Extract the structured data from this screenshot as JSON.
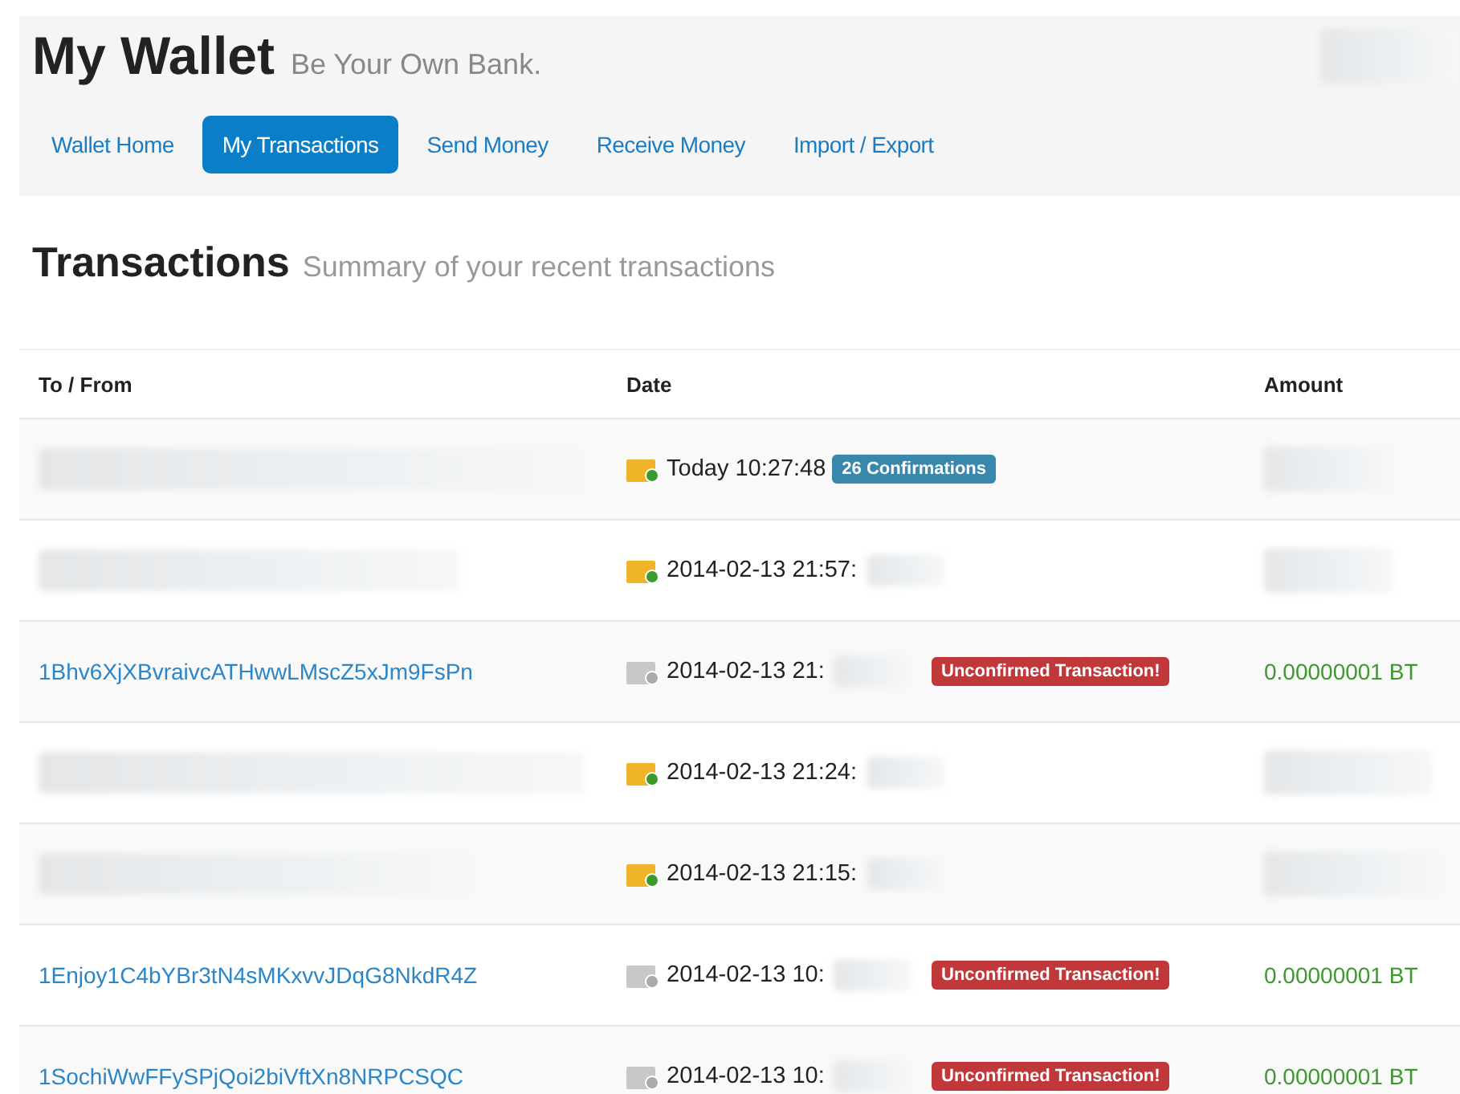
{
  "header": {
    "title": "My Wallet",
    "tagline": "Be Your Own Bank."
  },
  "tabs": [
    {
      "label": "Wallet Home",
      "selected": false
    },
    {
      "label": "My Transactions",
      "selected": true
    },
    {
      "label": "Send Money",
      "selected": false
    },
    {
      "label": "Receive Money",
      "selected": false
    },
    {
      "label": "Import / Export",
      "selected": false
    }
  ],
  "section": {
    "title": "Transactions",
    "subtitle": "Summary of your recent transactions"
  },
  "table": {
    "columns": [
      "To / From",
      "Date",
      "Amount"
    ],
    "rows": [
      {
        "confirmed": true,
        "date": "Today 10:27:48",
        "time_hidden": false,
        "badge": {
          "kind": "confirmations",
          "text": "26 Confirmations"
        }
      },
      {
        "confirmed": true,
        "date": "2014-02-13 21:57:",
        "time_hidden": true
      },
      {
        "confirmed": false,
        "address": "1Bhv6XjXBvraivcATHwwLMscZ5xJm9FsPn",
        "date": "2014-02-13 21:",
        "time_hidden": true,
        "badge": {
          "kind": "unconfirmed",
          "text": "Unconfirmed Transaction!"
        },
        "amount": "0.00000001 BT"
      },
      {
        "confirmed": true,
        "date": "2014-02-13 21:24:",
        "time_hidden": true
      },
      {
        "confirmed": true,
        "date": "2014-02-13 21:15:",
        "time_hidden": true
      },
      {
        "confirmed": false,
        "address": "1Enjoy1C4bYBr3tN4sMKxvvJDqG8NkdR4Z",
        "date": "2014-02-13 10:",
        "time_hidden": true,
        "badge": {
          "kind": "unconfirmed",
          "text": "Unconfirmed Transaction!"
        },
        "amount": "0.00000001 BT"
      },
      {
        "confirmed": false,
        "address": "1SochiWwFFySPjQoi2biVftXn8NRPCSQC",
        "date": "2014-02-13 10:",
        "time_hidden": true,
        "badge": {
          "kind": "unconfirmed",
          "text": "Unconfirmed Transaction!"
        },
        "amount": "0.00000001 BT"
      }
    ]
  }
}
